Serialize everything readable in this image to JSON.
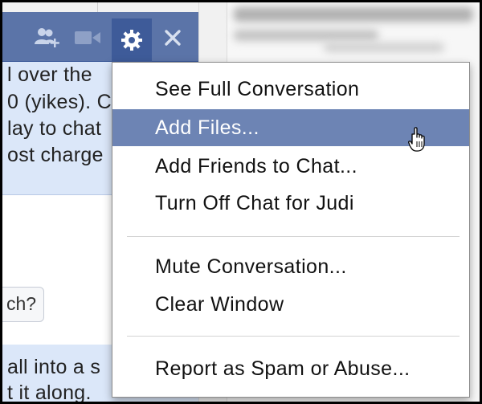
{
  "chat": {
    "toolbar_icons": [
      "add-friends-icon",
      "video-icon",
      "gear-icon",
      "close-icon"
    ],
    "message_lines": [
      "l over the",
      "0 (yikes). C",
      "lay to chat",
      "ost charge"
    ],
    "suggestion_text": "ch?",
    "message2_lines": [
      "all into a s",
      "t it along."
    ]
  },
  "menu": {
    "items": [
      {
        "label": "See Full Conversation",
        "active": false
      },
      {
        "label": "Add Files...",
        "active": true
      },
      {
        "label": "Add Friends to Chat...",
        "active": false
      },
      {
        "label": "Turn Off Chat for Judi",
        "active": false
      },
      {
        "label": "Mute Conversation...",
        "active": false
      },
      {
        "label": "Clear Window",
        "active": false
      },
      {
        "label": "Report as Spam or Abuse...",
        "active": false
      }
    ]
  },
  "colors": {
    "titlebar": "#5b74a8",
    "gear_active": "#3e5b99",
    "bubble": "#dbe7f9",
    "menu_highlight": "#6d84b4"
  }
}
